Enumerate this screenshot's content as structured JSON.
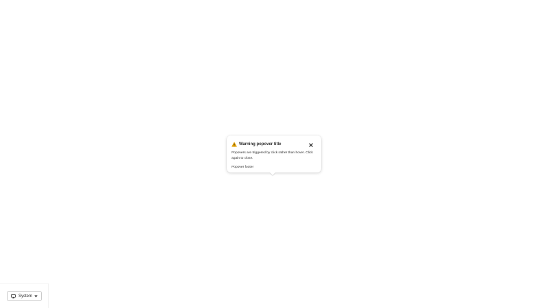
{
  "popover": {
    "title": "Warning popover title",
    "body": "Popovers are triggered by click rather than hover. Click again to close.",
    "footer": "Popover footer",
    "icon": "warning-icon",
    "close_icon": "close-icon",
    "accent_color": "#e5a100"
  },
  "theme_selector": {
    "label": "System",
    "icon": "monitor-icon",
    "dropdown_icon": "caret-down-icon"
  }
}
